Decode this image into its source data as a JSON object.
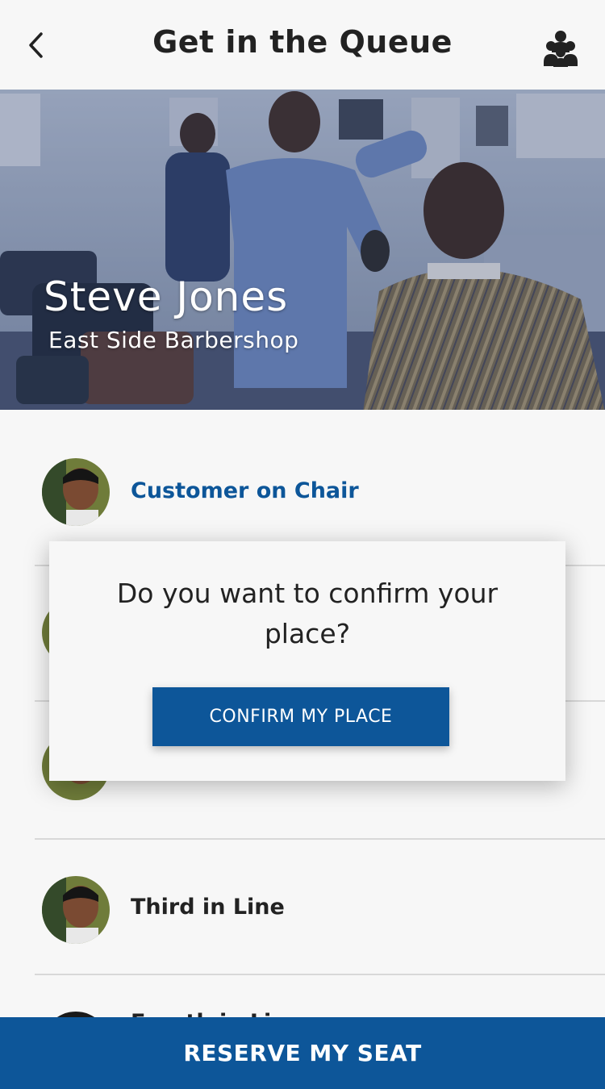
{
  "header": {
    "title": "Get in the Queue",
    "back_icon": "chevron-left-icon",
    "group_icon": "group-users-icon"
  },
  "hero": {
    "barber_name": "Steve Jones",
    "shop_name": "East Side Barbershop"
  },
  "queue": {
    "items": [
      {
        "label": "Customer on Chair",
        "active": true
      },
      {
        "label": "",
        "active": false
      },
      {
        "label": "",
        "active": false
      },
      {
        "label": "Third in Line",
        "active": false
      },
      {
        "label": "Fourth in Line",
        "active": false
      }
    ]
  },
  "modal": {
    "message": "Do you want to confirm your place?",
    "confirm_label": "CONFIRM MY PLACE"
  },
  "footer": {
    "reserve_label": "RESERVE MY SEAT"
  },
  "colors": {
    "accent": "#0d5699",
    "background": "#f7f7f7",
    "text": "#222222"
  }
}
